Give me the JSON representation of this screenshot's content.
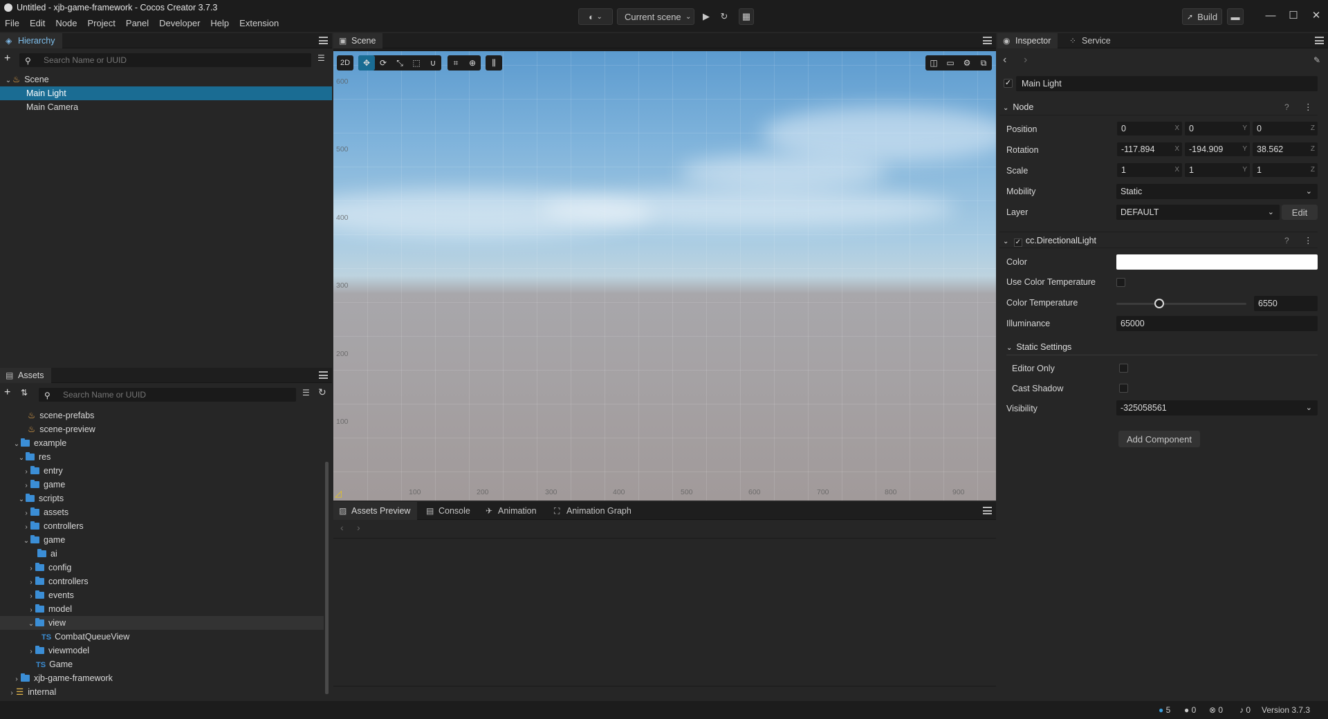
{
  "window": {
    "title": "Untitled - xjb-game-framework - Cocos Creator 3.7.3"
  },
  "menu": [
    "File",
    "Edit",
    "Node",
    "Project",
    "Panel",
    "Developer",
    "Help",
    "Extension"
  ],
  "toolbar": {
    "scene_select": "Current scene",
    "build_label": "Build"
  },
  "hierarchy": {
    "tab": "Hierarchy",
    "search_placeholder": "Search Name or UUID",
    "root": "Scene",
    "items": [
      "Main Light",
      "Main Camera"
    ]
  },
  "assets": {
    "tab": "Assets",
    "search_placeholder": "Search Name or UUID",
    "tree": [
      {
        "label": "scene-prefabs",
        "kind": "scene"
      },
      {
        "label": "scene-preview",
        "kind": "scene"
      },
      {
        "label": "example",
        "kind": "folder"
      },
      {
        "label": "res",
        "kind": "folder"
      },
      {
        "label": "entry",
        "kind": "folder"
      },
      {
        "label": "game",
        "kind": "folder"
      },
      {
        "label": "scripts",
        "kind": "folder"
      },
      {
        "label": "assets",
        "kind": "folder"
      },
      {
        "label": "controllers",
        "kind": "folder"
      },
      {
        "label": "game",
        "kind": "folder"
      },
      {
        "label": "ai",
        "kind": "folder"
      },
      {
        "label": "config",
        "kind": "folder"
      },
      {
        "label": "controllers",
        "kind": "folder"
      },
      {
        "label": "events",
        "kind": "folder"
      },
      {
        "label": "model",
        "kind": "folder"
      },
      {
        "label": "view",
        "kind": "folder"
      },
      {
        "label": "CombatQueueView",
        "kind": "ts"
      },
      {
        "label": "viewmodel",
        "kind": "folder"
      },
      {
        "label": "Game",
        "kind": "ts"
      },
      {
        "label": "xjb-game-framework",
        "kind": "folder"
      },
      {
        "label": "internal",
        "kind": "db"
      }
    ]
  },
  "scene": {
    "tab": "Scene",
    "mode": "2D",
    "y_ticks": [
      "600",
      "500",
      "400",
      "300",
      "200",
      "100"
    ],
    "x_ticks": [
      "100",
      "200",
      "300",
      "400",
      "500",
      "600",
      "700",
      "800",
      "900"
    ]
  },
  "bottom_tabs": [
    "Assets Preview",
    "Console",
    "Animation",
    "Animation Graph"
  ],
  "inspector": {
    "tabs": [
      "Inspector",
      "Service"
    ],
    "node_name": "Main Light",
    "node_section": "Node",
    "position": {
      "label": "Position",
      "x": "0",
      "y": "0",
      "z": "0"
    },
    "rotation": {
      "label": "Rotation",
      "x": "-117.894",
      "y": "-194.909",
      "z": "38.562"
    },
    "scale": {
      "label": "Scale",
      "x": "1",
      "y": "1",
      "z": "1"
    },
    "mobility": {
      "label": "Mobility",
      "value": "Static"
    },
    "layer": {
      "label": "Layer",
      "value": "DEFAULT",
      "edit": "Edit"
    },
    "component": "cc.DirectionalLight",
    "color_label": "Color",
    "color_value": "#ffffff",
    "use_color_temp": "Use Color Temperature",
    "color_temp": {
      "label": "Color Temperature",
      "value": "6550",
      "fraction": 0.33
    },
    "illuminance": {
      "label": "Illuminance",
      "value": "65000"
    },
    "static_settings": "Static Settings",
    "editor_only": "Editor Only",
    "cast_shadow": "Cast Shadow",
    "visibility": {
      "label": "Visibility",
      "value": "-325058561"
    },
    "add_component": "Add Component"
  },
  "statusbar": {
    "info": "5",
    "warn": "0",
    "error": "0",
    "notify": "0",
    "version": "Version 3.7.3"
  },
  "axis_letters": {
    "x": "X",
    "y": "Y",
    "z": "Z"
  }
}
